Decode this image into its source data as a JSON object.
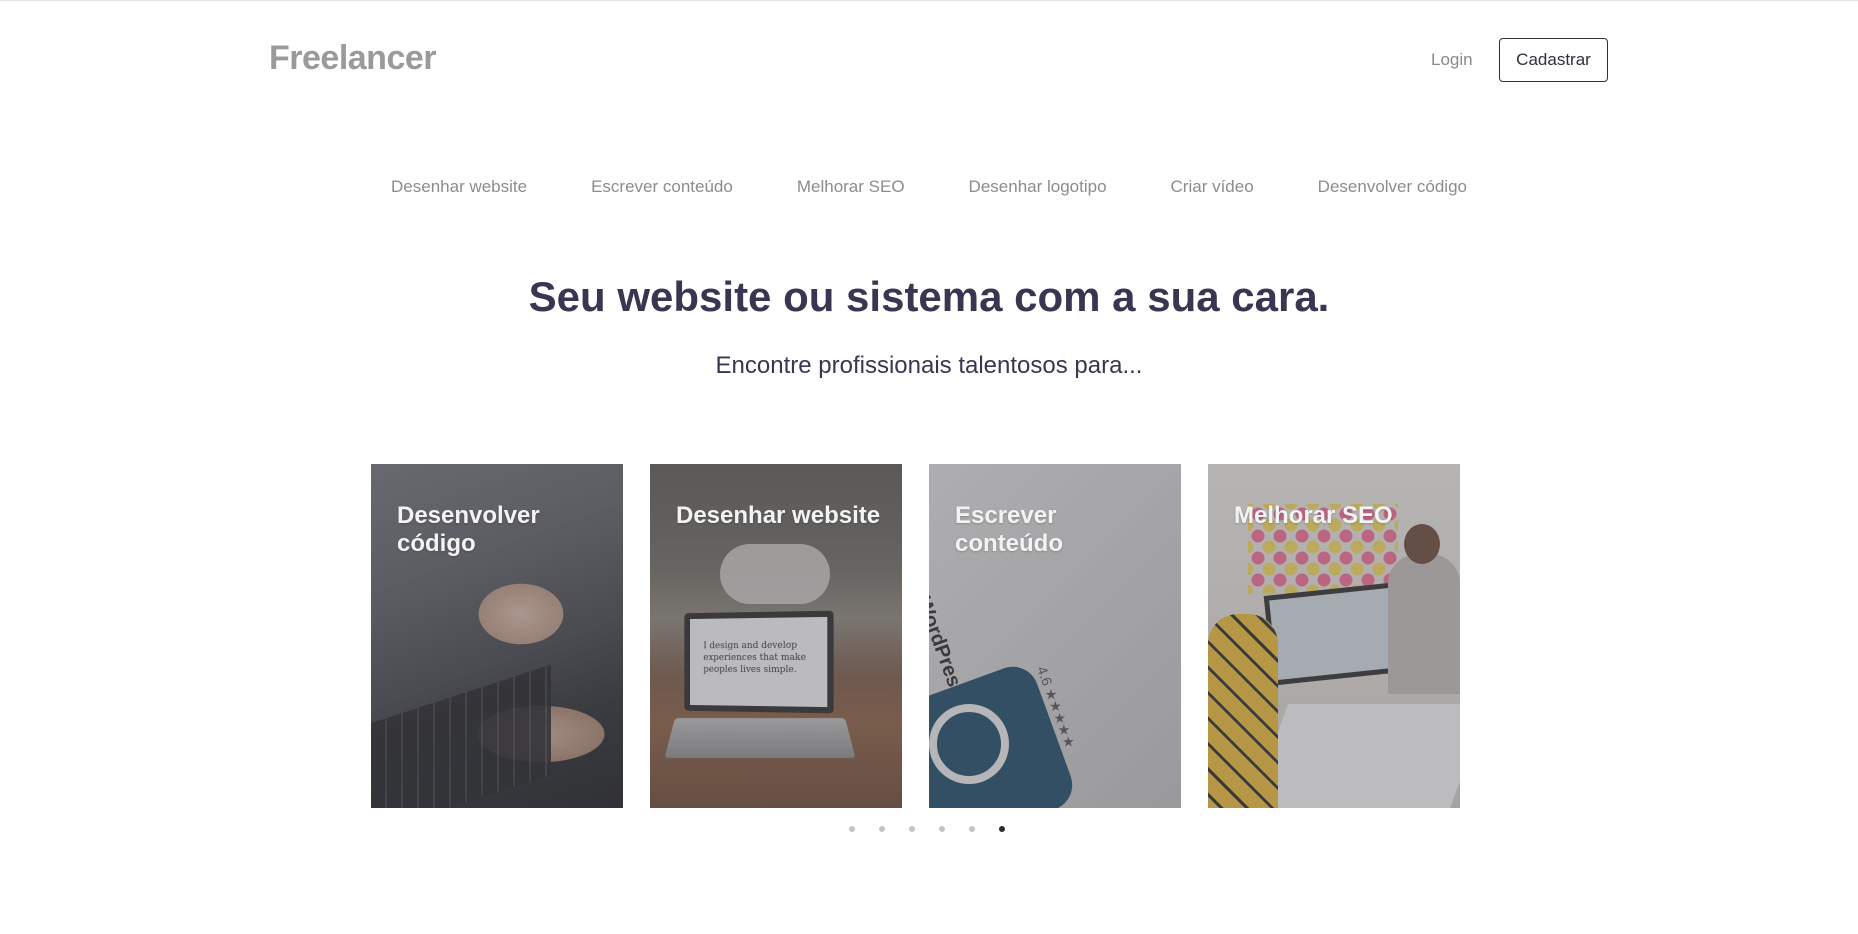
{
  "header": {
    "brand": "Freelancer",
    "login_label": "Login",
    "signup_label": "Cadastrar"
  },
  "categories": [
    "Desenhar website",
    "Escrever conteúdo",
    "Melhorar SEO",
    "Desenhar logotipo",
    "Criar vídeo",
    "Desenvolver código"
  ],
  "hero": {
    "title": "Seu website ou sistema com a sua cara.",
    "subtitle": "Encontre profissionais talentosos para..."
  },
  "cards": [
    {
      "label": "Desenvolver código",
      "image": "typing-on-laptop"
    },
    {
      "label": "Desenhar website",
      "image": "laptop-on-table",
      "screen_text": "I design and develop experiences that make peoples lives simple."
    },
    {
      "label": "Escrever conteúdo",
      "image": "wordpress-app-store",
      "screen_text": "WordPress",
      "rating": "4.6 ★★★★★"
    },
    {
      "label": "Melhorar SEO",
      "image": "office-meeting"
    }
  ],
  "carousel": {
    "dot_count": 6,
    "active_index": 5
  },
  "colors": {
    "brand": "#9a9a9a",
    "heading": "#3a3550",
    "nav_text": "#8c8c8c",
    "button_border": "#2f2f3a",
    "dot_active": "#2a2a2a",
    "dot_inactive": "#c4c4c4"
  }
}
